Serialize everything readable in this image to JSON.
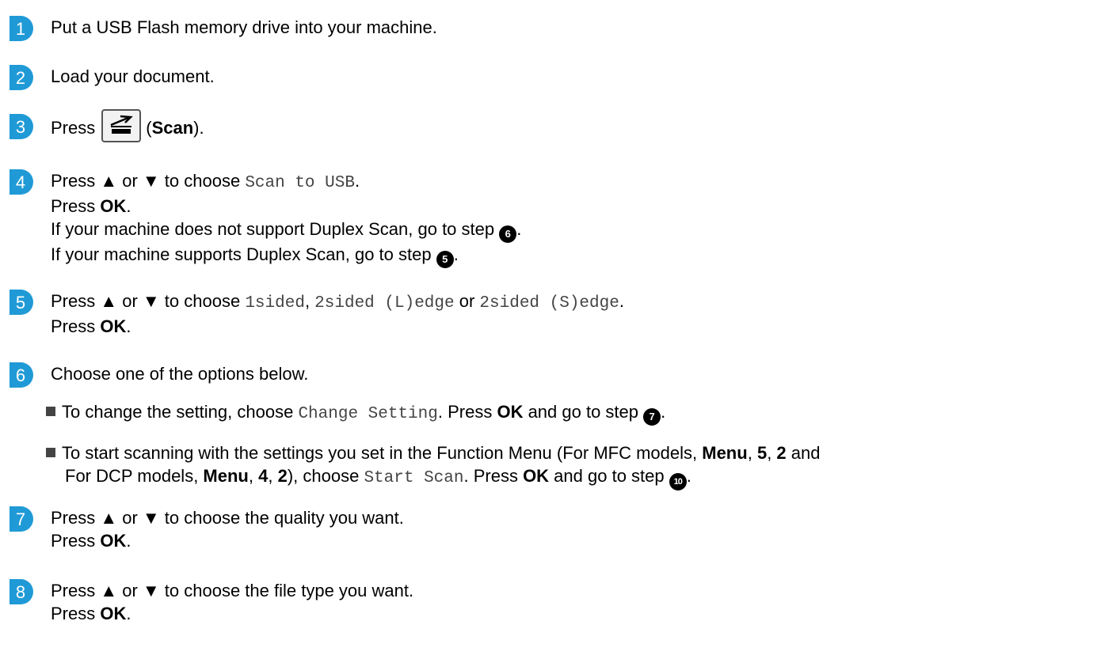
{
  "colors": {
    "badge": "#1f9ad6",
    "badge_text": "#ffffff",
    "mono_text": "#444444"
  },
  "steps": [
    {
      "num": "1",
      "lines": [
        {
          "text": "Put a USB Flash memory drive into your machine."
        }
      ]
    },
    {
      "num": "2",
      "lines": [
        {
          "text": "Load your document."
        }
      ]
    },
    {
      "num": "3",
      "press": "Press",
      "button_icon": "scan-icon",
      "scan_label": "Scan",
      "paren_open": "(",
      "paren_close": ")."
    },
    {
      "num": "4",
      "l1_a": "Press ▲ or ▼ to choose ",
      "l1_mono": "Scan to USB",
      "l1_end": ".",
      "l2_a": "Press ",
      "l2_b": "OK",
      "l2_end": ".",
      "l3_a": "If your machine does not support Duplex Scan, go to step ",
      "l3_ref": "6",
      "l3_end": ".",
      "l4_a": "If your machine supports Duplex Scan, go to step ",
      "l4_ref": "5",
      "l4_end": "."
    },
    {
      "num": "5",
      "l1_a": "Press ▲ or ▼ to choose ",
      "l1_m1": "1sided",
      "l1_sep": ", ",
      "l1_m2": "2sided (L)edge",
      "l1_or": " or ",
      "l1_m3": "2sided (S)edge",
      "l1_end": ".",
      "l2_a": "Press ",
      "l2_b": "OK",
      "l2_end": "."
    },
    {
      "num": "6",
      "l1": "Choose one of the options below.",
      "b1_a": "To change the setting, choose ",
      "b1_mono": "Change Setting",
      "b1_b": ". Press ",
      "b1_ok": "OK",
      "b1_c": " and go to step ",
      "b1_ref": "7",
      "b1_end": ".",
      "b2_a": "To start scanning with the settings you set in the Function Menu (For MFC models, ",
      "b2_menu": "Menu",
      "b2_s1": ", ",
      "b2_5": "5",
      "b2_s2": ", ",
      "b2_2": "2",
      "b2_and": " and",
      "b2_l2a": "For DCP models, ",
      "b2_menu2": "Menu",
      "b2_s3": ", ",
      "b2_4": "4",
      "b2_s4": ", ",
      "b2_2b": "2",
      "b2_l2b": "), choose ",
      "b2_mono": "Start Scan",
      "b2_l2c": ". Press ",
      "b2_ok": "OK",
      "b2_l2d": " and go to step ",
      "b2_ref": "10",
      "b2_end": "."
    },
    {
      "num": "7",
      "l1": "Press ▲ or ▼ to choose the quality you want.",
      "l2_a": "Press ",
      "l2_b": "OK",
      "l2_end": "."
    },
    {
      "num": "8",
      "l1": "Press ▲ or ▼ to choose the file type you want.",
      "l2_a": "Press ",
      "l2_b": "OK",
      "l2_end": "."
    }
  ]
}
